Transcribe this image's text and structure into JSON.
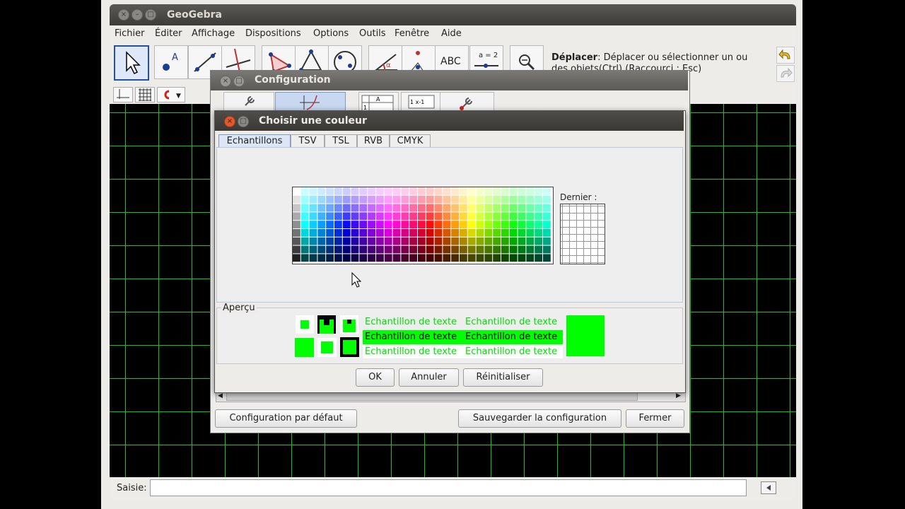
{
  "app": {
    "title": "GeoGebra"
  },
  "menu": [
    "Fichier",
    "Éditer",
    "Affichage",
    "Dispositions",
    "Options",
    "Outils",
    "Fenêtre",
    "Aide"
  ],
  "toolbar": {
    "tools": [
      "move",
      "point",
      "line",
      "perpendicular",
      "polygon",
      "circle",
      "circle-three-points",
      "angle",
      "reflect",
      "text",
      "slider",
      "zoom"
    ],
    "text_tool_label": "ABC",
    "slider_tool_label": "a = 2",
    "help_title": "Déplacer",
    "help_body": ": Déplacer ou sélectionner un ou des objets(Ctrl) (Raccourci : Esc)"
  },
  "input": {
    "label": "Saisie:",
    "value": ""
  },
  "config": {
    "title": "Configuration",
    "buttons": {
      "defaults": "Configuration par défaut",
      "save": "Sauvegarder la configuration",
      "close": "Fermer"
    }
  },
  "color_dialog": {
    "title": "Choisir une couleur",
    "tabs": [
      "Echantillons",
      "TSV",
      "TSL",
      "RVB",
      "CMYK"
    ],
    "recent_label": "Dernier :",
    "preview_label": "Aperçu",
    "sample_text": "Echantillon de texte",
    "preview_color": "#00ff00",
    "buttons": {
      "ok": "OK",
      "cancel": "Annuler",
      "reset": "Réinitialiser"
    }
  },
  "colors": {
    "grid": "#10c810",
    "canvas": "#000000",
    "accent": "#2350a8"
  }
}
